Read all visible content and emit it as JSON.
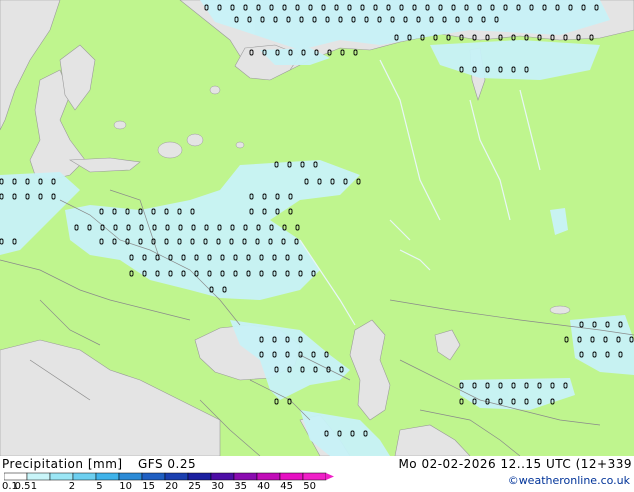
{
  "legend": {
    "title": "Precipitation [mm]",
    "model": "GFS 0.25",
    "valid_time": "Mo 02-02-2026 12..15 UTC (12+339",
    "credit": "©weatheronline.co.uk",
    "ticks": [
      "0.1",
      "0.5",
      "1",
      "2",
      "5",
      "10",
      "15",
      "20",
      "25",
      "30",
      "35",
      "40",
      "45",
      "50"
    ],
    "colors": [
      "#fefefe",
      "#c9f5f9",
      "#9be6f5",
      "#6ccff0",
      "#3fb3ea",
      "#2b8ad6",
      "#1f5fc2",
      "#1a3fb0",
      "#1a1fa0",
      "#4d0ea6",
      "#8a0bb0",
      "#c10cb8",
      "#e60fc2",
      "#f020c8"
    ]
  },
  "map": {
    "land_color": "#bff58e",
    "sea_color": "#e4e4e4",
    "precip_color": "#c8f2f8"
  }
}
